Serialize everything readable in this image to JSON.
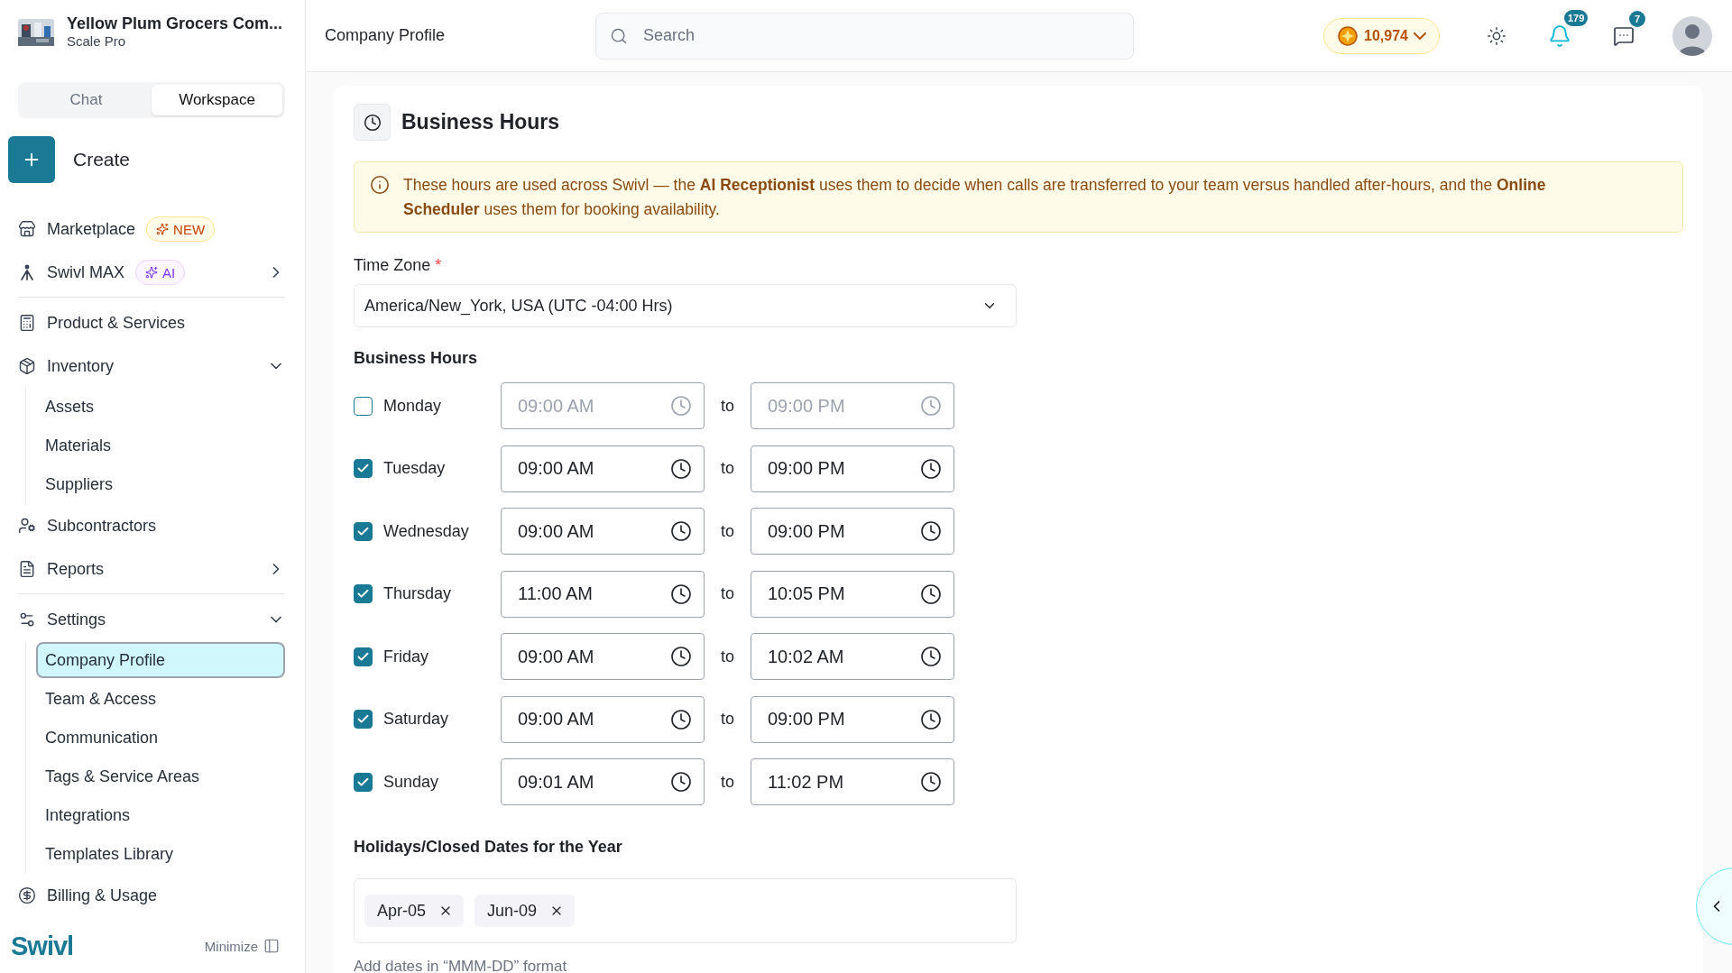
{
  "org": {
    "name": "Yellow Plum Grocers Com...",
    "plan": "Scale Pro"
  },
  "mode_tabs": [
    {
      "label": "Chat",
      "selected": false
    },
    {
      "label": "Workspace",
      "selected": true
    }
  ],
  "create_button": {
    "label": "Create"
  },
  "nav_sections": [
    [
      {
        "label": "Marketplace",
        "badge": {
          "kind": "new",
          "text": "NEW"
        }
      },
      {
        "label": "Swivl MAX",
        "badge": {
          "kind": "ai",
          "text": "AI"
        },
        "expanded": false
      }
    ],
    [
      {
        "label": "Product & Services"
      },
      {
        "label": "Inventory",
        "expanded": true,
        "children": [
          {
            "label": "Assets",
            "selected": false
          },
          {
            "label": "Materials",
            "selected": false
          },
          {
            "label": "Suppliers",
            "selected": false
          }
        ]
      },
      {
        "label": "Subcontractors"
      },
      {
        "label": "Reports",
        "expanded": false
      }
    ],
    [
      {
        "label": "Settings",
        "expanded": true,
        "children": [
          {
            "label": "Company Profile",
            "selected": true
          },
          {
            "label": "Team & Access",
            "selected": false
          },
          {
            "label": "Communication",
            "selected": false
          },
          {
            "label": "Tags & Service Areas",
            "selected": false
          },
          {
            "label": "Integrations",
            "selected": false
          },
          {
            "label": "Templates Library",
            "selected": false
          }
        ]
      },
      {
        "label": "Billing & Usage"
      }
    ]
  ],
  "footer": {
    "brand": "Swivl",
    "minimize": "Minimize"
  },
  "header": {
    "title": "Company Profile",
    "search_placeholder": "Search",
    "credits": "10,974",
    "notifications": "179",
    "messages": "7"
  },
  "section": {
    "title": "Business Hours",
    "notice": "These hours are used across Swivl — the **AI Receptionist** uses them to decide when calls are transferred to your team versus handled after-hours, and the **Online Scheduler** uses them for booking availability."
  },
  "time_zone": {
    "label": "Time Zone",
    "required": true,
    "required_mark": "*",
    "value": "America/New_York, USA (UTC -04:00 Hrs)"
  },
  "hours": {
    "label": "Business Hours",
    "days": [
      {
        "day": "Monday",
        "checked": false,
        "start": "09:00 AM",
        "separator": "to",
        "end": "09:00 PM"
      },
      {
        "day": "Tuesday",
        "checked": true,
        "start": "09:00 AM",
        "separator": "to",
        "end": "09:00 PM"
      },
      {
        "day": "Wednesday",
        "checked": true,
        "start": "09:00 AM",
        "separator": "to",
        "end": "09:00 PM"
      },
      {
        "day": "Thursday",
        "checked": true,
        "start": "11:00 AM",
        "separator": "to",
        "end": "10:05 PM"
      },
      {
        "day": "Friday",
        "checked": true,
        "start": "09:00 AM",
        "separator": "to",
        "end": "10:02 AM"
      },
      {
        "day": "Saturday",
        "checked": true,
        "start": "09:00 AM",
        "separator": "to",
        "end": "09:00 PM"
      },
      {
        "day": "Sunday",
        "checked": true,
        "start": "09:01 AM",
        "separator": "to",
        "end": "11:02 PM"
      }
    ]
  },
  "holidays": {
    "label": "Holidays/Closed Dates for the Year",
    "dates": [
      "Apr-05",
      "Jun-09"
    ],
    "helper": "Add dates in “MMM-DD” format"
  }
}
